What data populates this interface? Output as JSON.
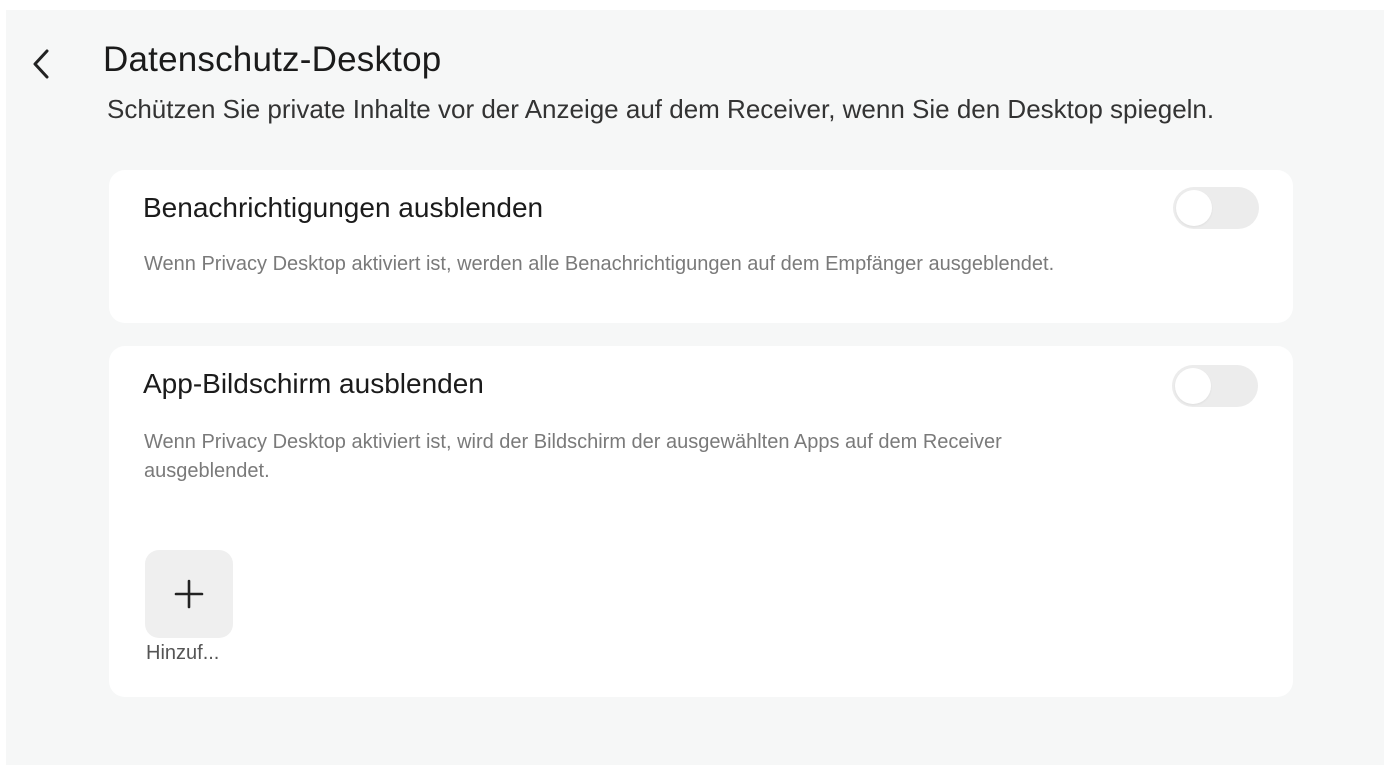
{
  "header": {
    "title": "Datenschutz-Desktop",
    "subtitle": "Schützen Sie private Inhalte vor der Anzeige auf dem Receiver, wenn Sie den Desktop spiegeln.",
    "back_icon": "chevron-left-icon"
  },
  "settings": [
    {
      "title": "Benachrichtigungen ausblenden",
      "description": "Wenn Privacy Desktop aktiviert ist, werden alle Benachrichtigungen auf dem Empfänger ausgeblendet.",
      "toggle_on": false
    },
    {
      "title": "App-Bildschirm ausblenden",
      "description": "Wenn Privacy Desktop aktiviert ist, wird der Bildschirm der ausgewählten Apps auf dem Receiver ausgeblendet.",
      "toggle_on": false,
      "add_button": {
        "icon": "plus-icon",
        "label": "Hinzuf..."
      }
    }
  ],
  "colors": {
    "background": "#f6f7f7",
    "card": "#ffffff",
    "toggle_off": "#ececec",
    "text_primary": "#1b1b1b",
    "text_secondary": "#7a7a7a"
  }
}
